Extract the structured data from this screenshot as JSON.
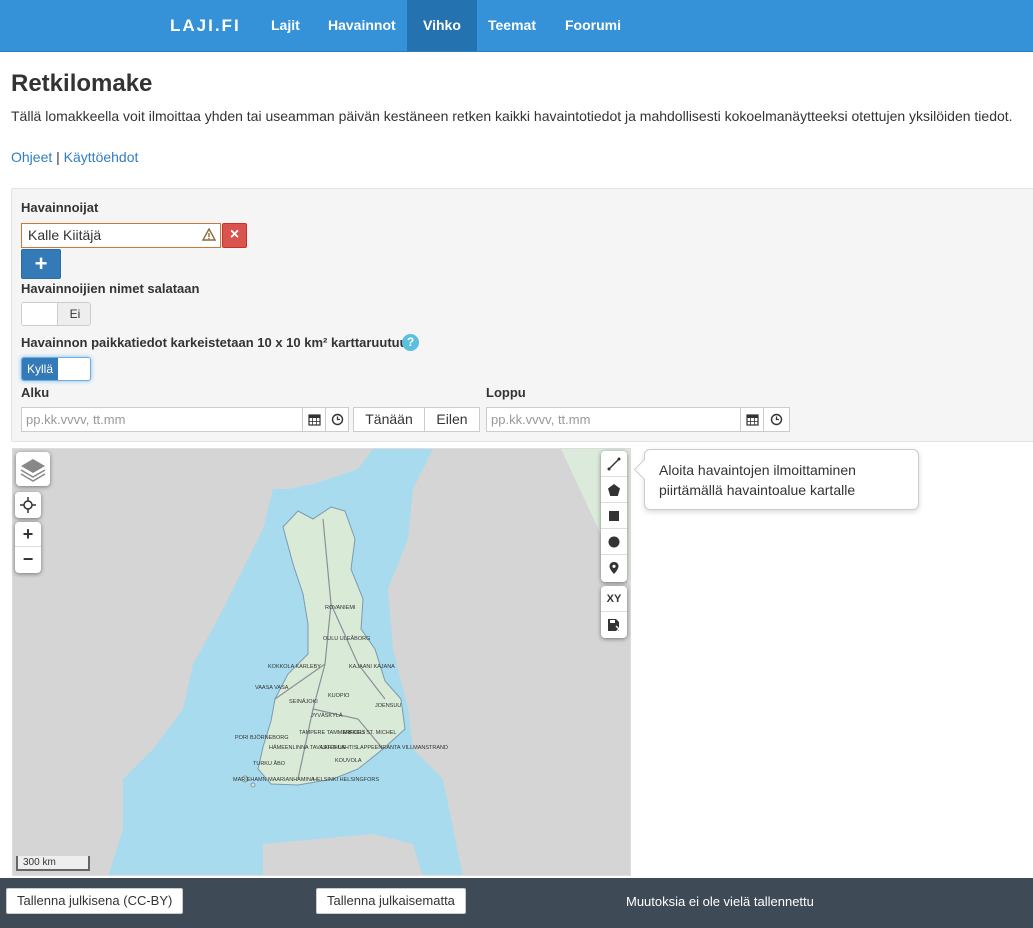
{
  "nav": {
    "brand": "LAJI.FI",
    "items": [
      {
        "label": "Lajit",
        "active": false
      },
      {
        "label": "Havainnot",
        "active": false
      },
      {
        "label": "Vihko",
        "active": true
      },
      {
        "label": "Teemat",
        "active": false
      },
      {
        "label": "Foorumi",
        "active": false
      }
    ]
  },
  "page": {
    "title": "Retkilomake",
    "description": "Tällä lomakkeella voit ilmoittaa yhden tai useamman päivän kestäneen retken kaikki havaintotiedot ja mahdollisesti kokoelmanäytteeksi otettujen yksilöiden tiedot.",
    "link_instructions": "Ohjeet",
    "link_separator": "|",
    "link_terms": "Käyttöehdot"
  },
  "form": {
    "observers_label": "Havainnoijat",
    "observer_value": "Kalle Kiitäjä",
    "remove_label": "×",
    "add_label": "+",
    "hide_names_label": "Havainnoijien nimet salataan",
    "hide_names_value": "Ei",
    "coarsen_label": "Havainnon paikkatiedot karkeistetaan 10 x 10 km² karttaruutuun",
    "coarsen_help": "?",
    "coarsen_value": "Kyllä",
    "start_label": "Alku",
    "end_label": "Loppu",
    "date_placeholder": "pp.kk.vvvv, tt.mm",
    "today_label": "Tänään",
    "yesterday_label": "Eilen"
  },
  "map": {
    "zoom_in": "+",
    "zoom_out": "−",
    "tool_xy": "XY",
    "scale_label": "300 km",
    "tooltip": "Aloita havaintojen ilmoittaminen piirtämällä havaintoalue kartalle",
    "city_labels": [
      "ROVANIEMI",
      "OULU ULEÅBORG",
      "KAJAANI KAJANA",
      "KOKKOLA KARLEBY",
      "KUOPIO",
      "VAASA VASA",
      "SEINÄJOKI",
      "JOENSUU",
      "JYVÄSKYLÄ",
      "PORI BJÖRNEBORG",
      "TAMPERE TAMMERFORS",
      "MIKKELI ST. MICHEL",
      "HÄMEENLINNA TAVASTEHUS",
      "LAHTI LAHTIS",
      "LAPPEENRANTA VILLMANSTRAND",
      "KOUVOLA",
      "TURKU ÅBO",
      "MARIEHAMN MAARIANHAMINA",
      "HELSINKI HELSINGFORS"
    ]
  },
  "footer": {
    "save_public": "Tallenna julkisena (CC-BY)",
    "save_private": "Tallenna julkaisematta",
    "status": "Muutoksia ei ole vielä tallennettu"
  },
  "colors": {
    "nav": "#3592d8",
    "nav_active": "#2473b0",
    "link": "#2f7ec2",
    "danger": "#d9534f",
    "primary": "#337ab7",
    "footer": "#3f4a57",
    "sea": "#a9dbef",
    "land_finland": "#d9ead7",
    "land_other": "#d5d5d5"
  }
}
